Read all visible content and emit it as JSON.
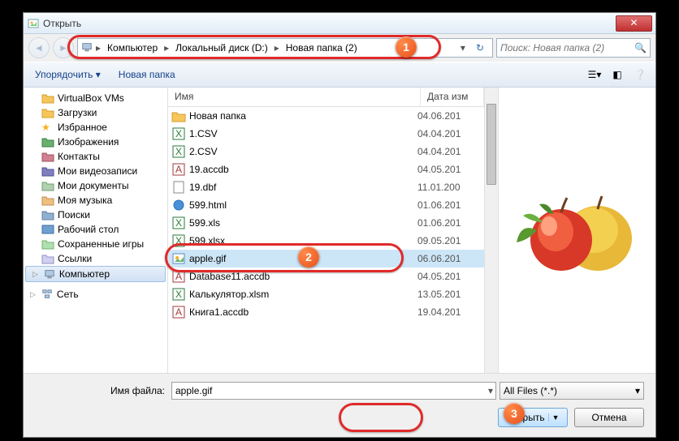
{
  "window": {
    "title": "Открыть"
  },
  "breadcrumb": {
    "seg1": "Компьютер",
    "seg2": "Локальный диск (D:)",
    "seg3": "Новая папка (2)"
  },
  "search": {
    "placeholder": "Поиск: Новая папка (2)"
  },
  "toolbar": {
    "organize": "Упорядочить",
    "newfolder": "Новая папка"
  },
  "sidebar": {
    "items": [
      {
        "label": "VirtualBox VMs",
        "icon": "folder"
      },
      {
        "label": "Загрузки",
        "icon": "folder"
      },
      {
        "label": "Избранное",
        "icon": "star"
      },
      {
        "label": "Изображения",
        "icon": "pictures"
      },
      {
        "label": "Контакты",
        "icon": "contacts"
      },
      {
        "label": "Мои видеозаписи",
        "icon": "video"
      },
      {
        "label": "Мои документы",
        "icon": "docs"
      },
      {
        "label": "Моя музыка",
        "icon": "music"
      },
      {
        "label": "Поиски",
        "icon": "search"
      },
      {
        "label": "Рабочий стол",
        "icon": "desktop"
      },
      {
        "label": "Сохраненные игры",
        "icon": "games"
      },
      {
        "label": "Ссылки",
        "icon": "links"
      }
    ],
    "computer": "Компьютер",
    "network": "Сеть"
  },
  "columns": {
    "name": "Имя",
    "date": "Дата изм"
  },
  "files": [
    {
      "name": "Новая папка",
      "date": "04.06.201",
      "icon": "folder"
    },
    {
      "name": "1.CSV",
      "date": "04.04.201",
      "icon": "xls"
    },
    {
      "name": "2.CSV",
      "date": "04.04.201",
      "icon": "xls"
    },
    {
      "name": "19.accdb",
      "date": "04.05.201",
      "icon": "accdb"
    },
    {
      "name": "19.dbf",
      "date": "11.01.200",
      "icon": "dbf"
    },
    {
      "name": "599.html",
      "date": "01.06.201",
      "icon": "html"
    },
    {
      "name": "599.xls",
      "date": "01.06.201",
      "icon": "xls"
    },
    {
      "name": "599.xlsx",
      "date": "09.05.201",
      "icon": "xls"
    },
    {
      "name": "apple.gif",
      "date": "06.06.201",
      "icon": "gif",
      "selected": true
    },
    {
      "name": "Database11.accdb",
      "date": "04.05.201",
      "icon": "accdb"
    },
    {
      "name": "Калькулятор.xlsm",
      "date": "13.05.201",
      "icon": "xls"
    },
    {
      "name": "Книга1.accdb",
      "date": "19.04.201",
      "icon": "accdb"
    }
  ],
  "filename": {
    "label": "Имя файла:",
    "value": "apple.gif"
  },
  "filter": {
    "value": "All Files (*.*)"
  },
  "buttons": {
    "open": "Открыть",
    "cancel": "Отмена"
  },
  "annotations": {
    "b1": "1",
    "b2": "2",
    "b3": "3"
  }
}
